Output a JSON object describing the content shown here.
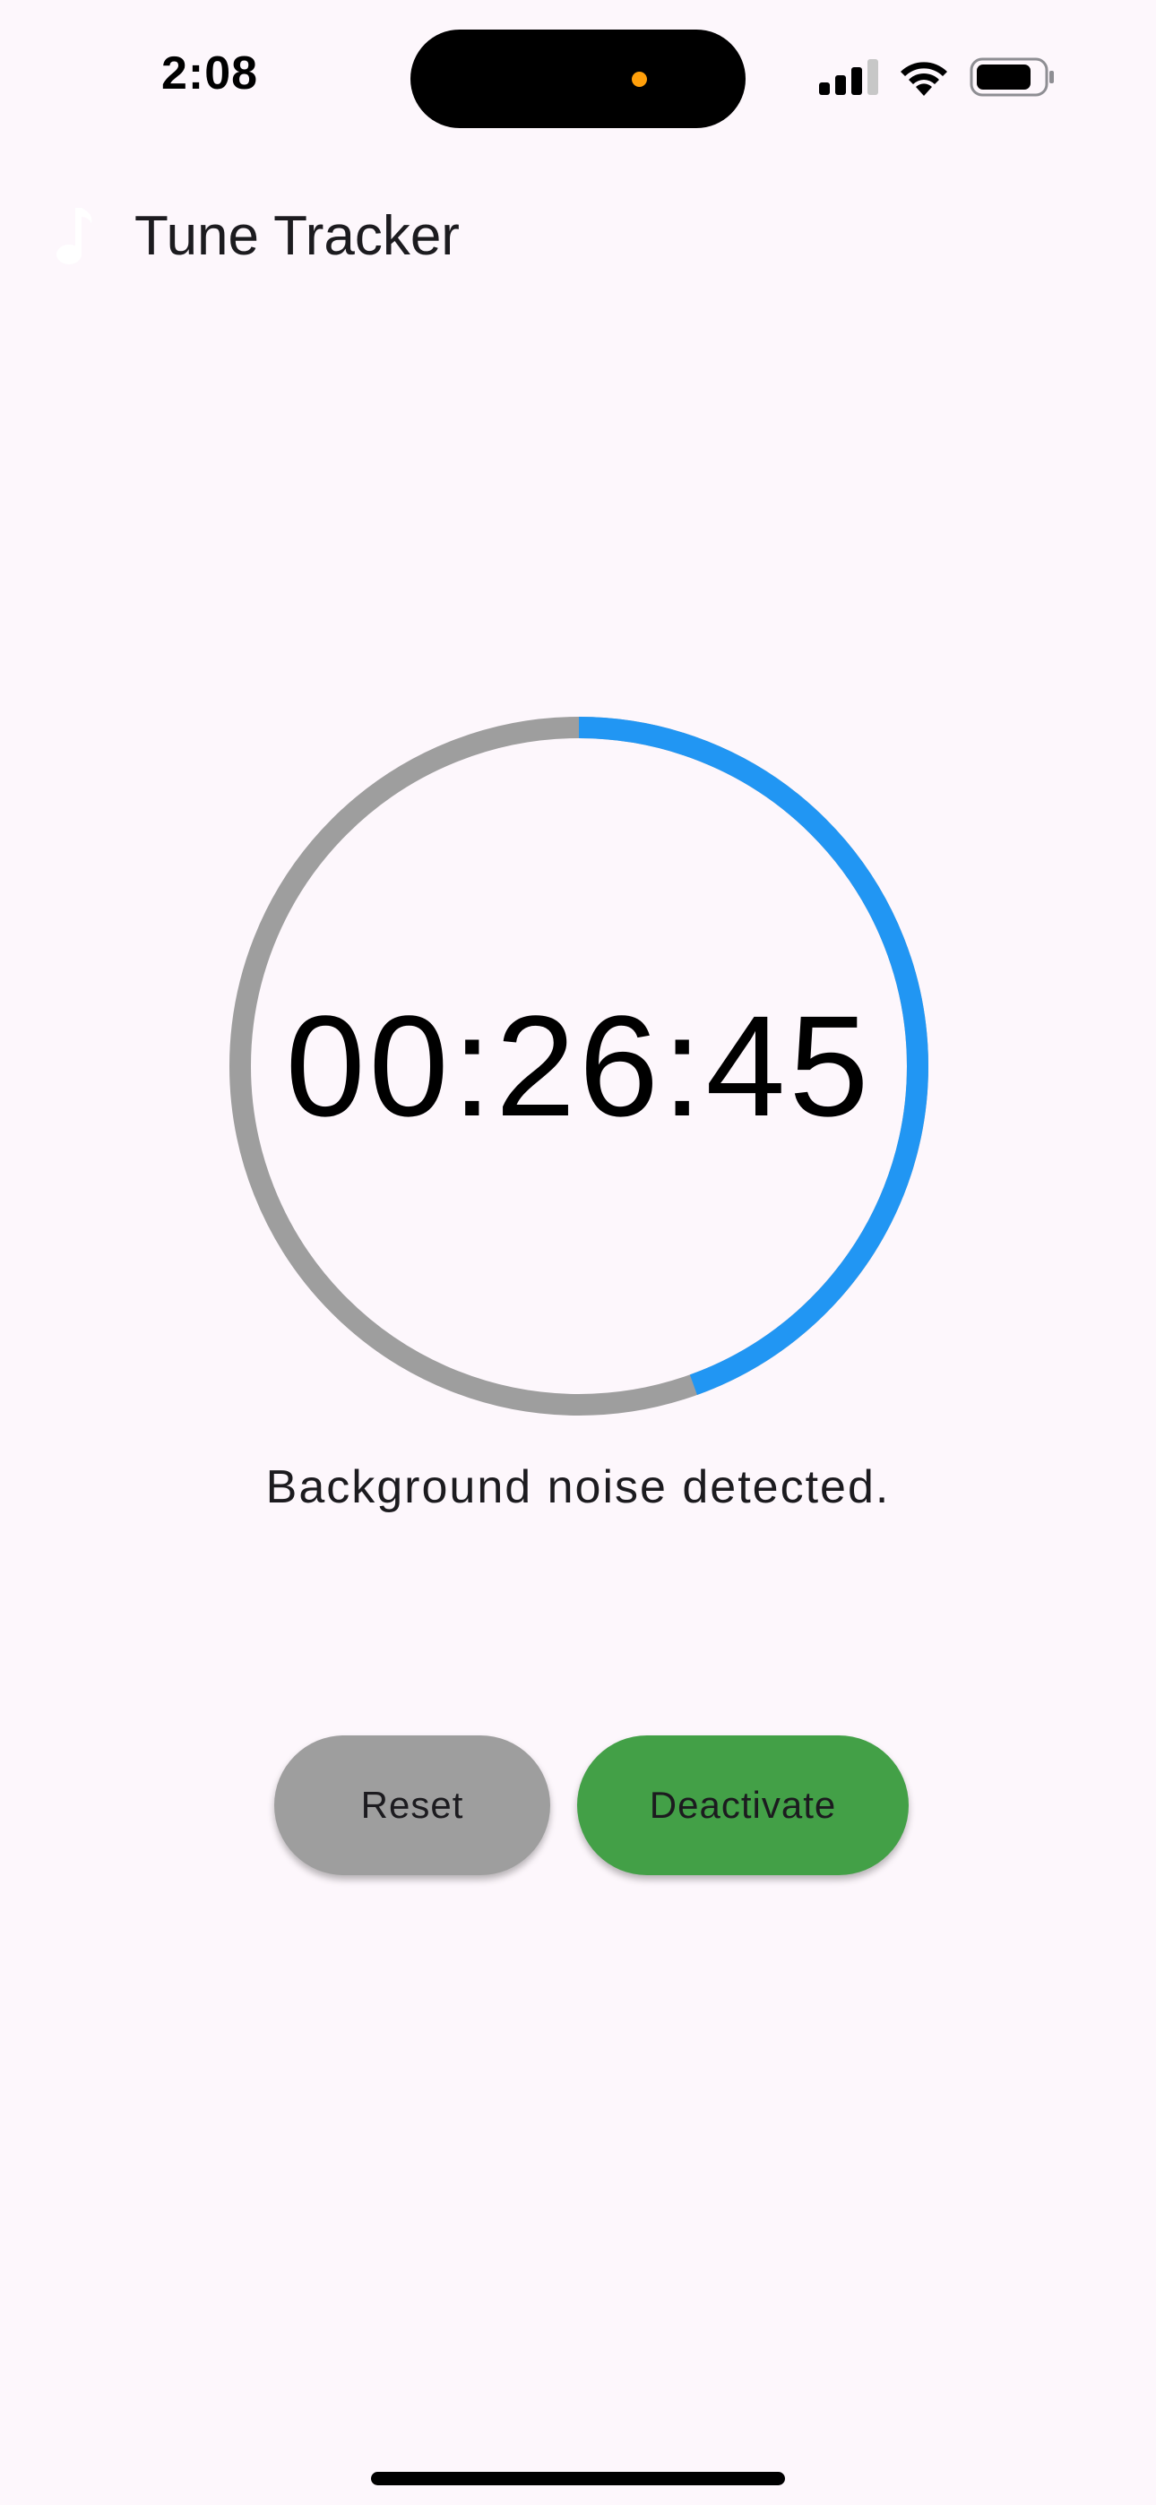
{
  "status_bar": {
    "time": "2:08"
  },
  "app_bar": {
    "title": "Tune Tracker",
    "icon": "music-note-icon"
  },
  "timer": {
    "display": "00:26:45",
    "progress": 0.445,
    "track_color": "#9E9E9E",
    "progress_color": "#2196F3"
  },
  "status_message": "Background noise detected.",
  "buttons": {
    "reset_label": "Reset",
    "deactivate_label": "Deactivate",
    "reset_color": "#9E9E9E",
    "deactivate_color": "#43A047"
  }
}
